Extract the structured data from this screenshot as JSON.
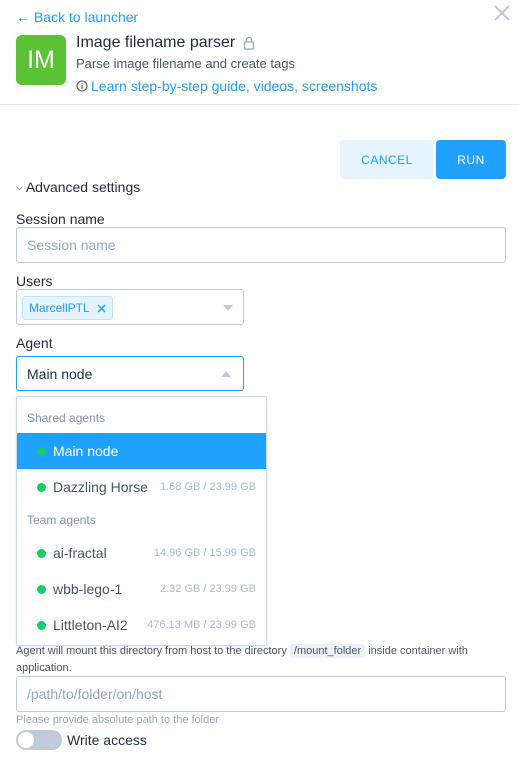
{
  "header": {
    "back_label": "← Back to launcher",
    "app_logo_text": "IM",
    "app_title": "Image filename parser",
    "app_description": "Parse image filename and create tags",
    "learn_link": "Learn step-by-step guide, videos, screenshots"
  },
  "actions": {
    "cancel_label": "CANCEL",
    "run_label": "RUN"
  },
  "advanced": {
    "toggle_label": "Advanced settings",
    "session_name": {
      "label": "Session name",
      "placeholder": "Session name",
      "value": ""
    },
    "users": {
      "label": "Users",
      "selected": [
        "MarcellPTL"
      ]
    },
    "agent": {
      "label": "Agent",
      "value": "Main node"
    }
  },
  "agent_dropdown": {
    "groups": [
      {
        "label": "Shared agents",
        "options": [
          {
            "name": "Main node",
            "memory": "",
            "selected": true
          },
          {
            "name": "Dazzling Horse",
            "memory": "1.68 GB / 23.99 GB",
            "selected": false
          }
        ]
      },
      {
        "label": "Team agents",
        "options": [
          {
            "name": "ai-fractal",
            "memory": "14.96 GB / 15.99 GB",
            "selected": false
          },
          {
            "name": "wbb-lego-1",
            "memory": "2.32 GB / 23.99 GB",
            "selected": false
          },
          {
            "name": "Littleton-AI2",
            "memory": "476.13 MB / 23.99 GB",
            "selected": false
          }
        ]
      }
    ]
  },
  "mount": {
    "help_before": "Agent will mount this directory from host to the directory",
    "target_dir": "/mount_folder",
    "help_after": "inside container with application.",
    "path_placeholder": "/path/to/folder/on/host",
    "path_value": "",
    "hint": "Please provide absolute path to the folder",
    "write_access_label": "Write access",
    "write_access_enabled": false
  },
  "colors": {
    "accent": "#20a0ff",
    "logo_bg": "#5bc235",
    "status_online": "#13ce66"
  }
}
